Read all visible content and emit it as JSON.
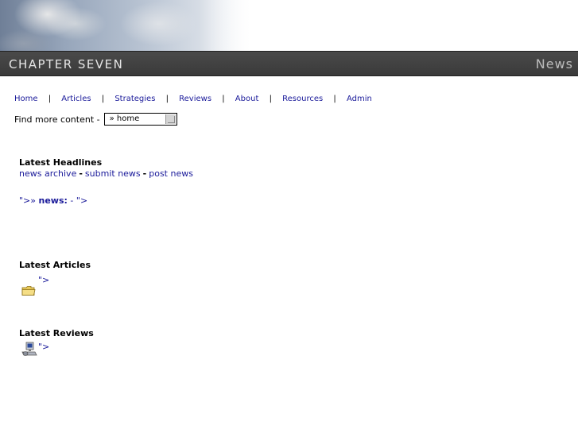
{
  "header": {
    "site_title": "CHAPTER SEVEN",
    "section_title": "News"
  },
  "nav": {
    "items": [
      "Home",
      "Articles",
      "Strategies",
      "Reviews",
      "About",
      "Resources",
      "Admin"
    ],
    "separator": "|"
  },
  "find_more": {
    "label": "Find more content -",
    "selected": "» home"
  },
  "headlines": {
    "title": "Latest Headlines",
    "links": [
      "news archive",
      "submit news",
      "post news"
    ],
    "separator": "-",
    "news_prefix": "\">» ",
    "news_label": "news:",
    "news_rest": " -  \">"
  },
  "articles": {
    "title": "Latest Articles",
    "item_text": "\">"
  },
  "reviews": {
    "title": "Latest Reviews",
    "item_text": "\">"
  },
  "colors": {
    "title_bar": "#3f3f3f",
    "link": "#1a1a9a",
    "site_title_text": "#e6e6e6",
    "section_title_text": "#bdbdbd"
  }
}
